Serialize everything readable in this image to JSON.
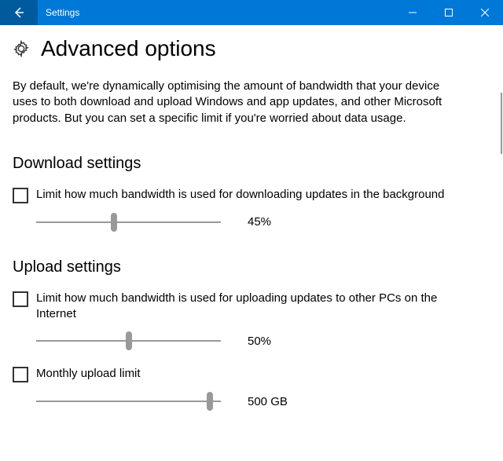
{
  "window": {
    "title": "Settings"
  },
  "page": {
    "title": "Advanced options",
    "description": "By default, we're dynamically optimising the amount of bandwidth that your device uses to both download and upload Windows and app updates, and other Microsoft products. But you can set a specific limit if you're worried about data usage."
  },
  "download": {
    "heading": "Download settings",
    "limit_label": "Limit how much bandwidth is used for downloading updates in the background",
    "slider_value": "45%",
    "slider_percent": 42
  },
  "upload": {
    "heading": "Upload settings",
    "limit_label": "Limit how much bandwidth is used for uploading updates to other PCs on the Internet",
    "slider_value": "50%",
    "slider_percent": 50,
    "monthly_label": "Monthly upload limit",
    "monthly_value": "500 GB",
    "monthly_percent": 94
  }
}
